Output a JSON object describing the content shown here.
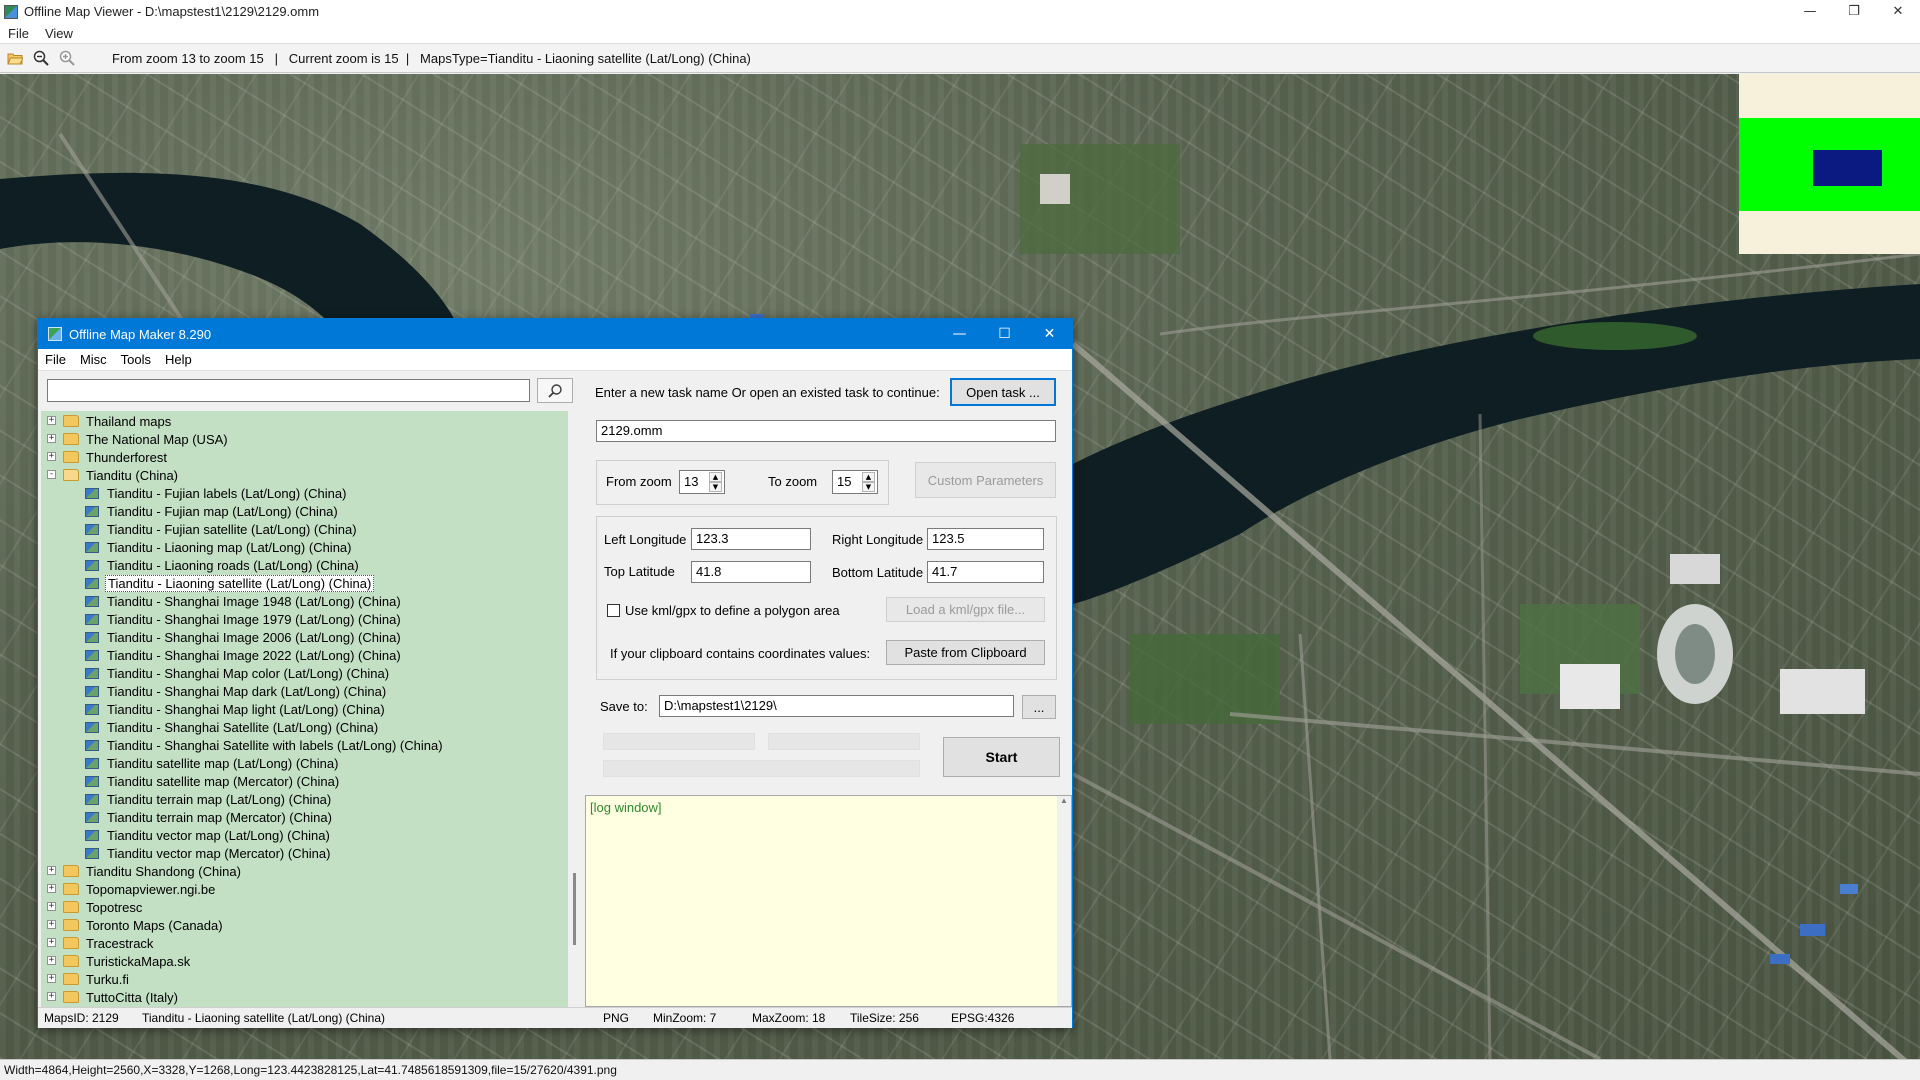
{
  "viewer": {
    "title": "Offline Map Viewer - D:\\mapstest1\\2129\\2129.omm",
    "menu": [
      "File",
      "View"
    ],
    "toolbar_info": "From zoom 13 to zoom 15   |   Current zoom is 15  |   MapsType=Tianditu - Liaoning satellite (Lat/Long) (China)",
    "status": "Width=4864,Height=2560,X=3328,Y=1268,Long=123.4423828125,Lat=41.7485618591309,file=15/27620/4391.png"
  },
  "dialog": {
    "title": "Offline Map Maker 8.290",
    "menu": [
      "File",
      "Misc",
      "Tools",
      "Help"
    ],
    "search": {
      "value": "",
      "placeholder": ""
    },
    "tree": [
      {
        "label": "Thailand maps",
        "kind": "folder",
        "level": 0
      },
      {
        "label": "The National Map (USA)",
        "kind": "folder",
        "level": 0
      },
      {
        "label": "Thunderforest",
        "kind": "folder",
        "level": 0
      },
      {
        "label": "Tianditu (China)",
        "kind": "folder-open",
        "level": 0
      },
      {
        "label": "Tianditu - Fujian labels (Lat/Long) (China)",
        "kind": "map",
        "level": 1
      },
      {
        "label": "Tianditu - Fujian map (Lat/Long) (China)",
        "kind": "map",
        "level": 1
      },
      {
        "label": "Tianditu - Fujian satellite (Lat/Long) (China)",
        "kind": "map",
        "level": 1
      },
      {
        "label": "Tianditu - Liaoning map (Lat/Long) (China)",
        "kind": "map",
        "level": 1
      },
      {
        "label": "Tianditu - Liaoning roads (Lat/Long) (China)",
        "kind": "map",
        "level": 1
      },
      {
        "label": "Tianditu - Liaoning satellite (Lat/Long) (China)",
        "kind": "map",
        "level": 1,
        "selected": true
      },
      {
        "label": "Tianditu - Shanghai Image 1948 (Lat/Long) (China)",
        "kind": "map",
        "level": 1
      },
      {
        "label": "Tianditu - Shanghai Image 1979 (Lat/Long) (China)",
        "kind": "map",
        "level": 1
      },
      {
        "label": "Tianditu - Shanghai Image 2006 (Lat/Long) (China)",
        "kind": "map",
        "level": 1
      },
      {
        "label": "Tianditu - Shanghai Image 2022 (Lat/Long) (China)",
        "kind": "map",
        "level": 1
      },
      {
        "label": "Tianditu - Shanghai Map color (Lat/Long) (China)",
        "kind": "map",
        "level": 1
      },
      {
        "label": "Tianditu - Shanghai Map dark (Lat/Long) (China)",
        "kind": "map",
        "level": 1
      },
      {
        "label": "Tianditu - Shanghai Map light (Lat/Long) (China)",
        "kind": "map",
        "level": 1
      },
      {
        "label": "Tianditu - Shanghai Satellite (Lat/Long) (China)",
        "kind": "map",
        "level": 1
      },
      {
        "label": "Tianditu - Shanghai Satellite with labels (Lat/Long) (China)",
        "kind": "map",
        "level": 1
      },
      {
        "label": "Tianditu satellite map (Lat/Long) (China)",
        "kind": "map",
        "level": 1
      },
      {
        "label": "Tianditu satellite map (Mercator) (China)",
        "kind": "map",
        "level": 1
      },
      {
        "label": "Tianditu terrain map (Lat/Long) (China)",
        "kind": "map",
        "level": 1
      },
      {
        "label": "Tianditu terrain map (Mercator) (China)",
        "kind": "map",
        "level": 1
      },
      {
        "label": "Tianditu vector map (Lat/Long) (China)",
        "kind": "map",
        "level": 1
      },
      {
        "label": "Tianditu vector map (Mercator) (China)",
        "kind": "map",
        "level": 1
      },
      {
        "label": "Tianditu Shandong (China)",
        "kind": "folder",
        "level": 0
      },
      {
        "label": "Topomapviewer.ngi.be",
        "kind": "folder",
        "level": 0
      },
      {
        "label": "Topotresc",
        "kind": "folder",
        "level": 0
      },
      {
        "label": "Toronto Maps (Canada)",
        "kind": "folder",
        "level": 0
      },
      {
        "label": "Tracestrack",
        "kind": "folder",
        "level": 0
      },
      {
        "label": "TuristickaMapa.sk",
        "kind": "folder",
        "level": 0
      },
      {
        "label": "Turku.fi",
        "kind": "folder",
        "level": 0
      },
      {
        "label": "TuttoCitta (Italy)",
        "kind": "folder",
        "level": 0
      }
    ],
    "task_prompt": "Enter a new task name Or open an existed task to continue:",
    "open_task_label": "Open task ...",
    "task_name": "2129.omm",
    "from_zoom_label": "From zoom",
    "from_zoom": "13",
    "to_zoom_label": "To zoom",
    "to_zoom": "15",
    "custom_params_label": "Custom Parameters",
    "left_lon_label": "Left Longitude",
    "left_lon": "123.3",
    "right_lon_label": "Right Longitude",
    "right_lon": "123.5",
    "top_lat_label": "Top Latitude",
    "top_lat": "41.8",
    "bottom_lat_label": "Bottom Latitude",
    "bottom_lat": "41.7",
    "kml_check_label": "Use kml/gpx to define a polygon area",
    "kml_checked": false,
    "load_kml_label": "Load a kml/gpx file...",
    "clipboard_prompt": "If your clipboard contains coordinates values:",
    "paste_label": "Paste from Clipboard",
    "save_to_label": "Save to:",
    "save_to": "D:\\mapstest1\\2129\\",
    "browse_label": "...",
    "start_label": "Start",
    "log_text": "[log window]",
    "status": {
      "maps_id": "MapsID: 2129",
      "maps_name": "Tianditu - Liaoning satellite (Lat/Long) (China)",
      "format": "PNG",
      "min_zoom": "MinZoom: 7",
      "max_zoom": "MaxZoom: 18",
      "tile_size": "TileSize: 256",
      "epsg": "EPSG:4326"
    }
  },
  "colors": {
    "dialog_accent": "#0078d7",
    "tree_background": "#c3dfc4",
    "log_background": "#ffffe1",
    "overview_green": "#00ff00",
    "overview_viewport": "#0a1a80",
    "river": "#0e1e22"
  }
}
